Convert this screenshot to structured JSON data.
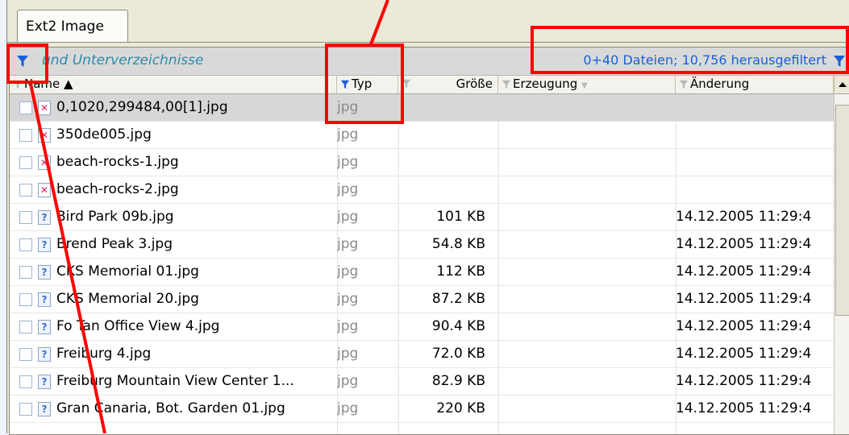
{
  "tab": {
    "label": "Ext2 Image"
  },
  "filterbar": {
    "subdirs_text": "und Unterverzeichnisse",
    "status": "0+40 Dateien; 10,756 herausgefiltert"
  },
  "columns": {
    "name": "Name ▲",
    "type": "Typ",
    "size": "Größe",
    "created": "Erzeugung",
    "modified": "Änderung"
  },
  "rows": [
    {
      "name": "0,1020,299484,00[1].jpg",
      "type": "jpg",
      "size": "",
      "created": "",
      "modified": "",
      "icon": "broken-image-icon"
    },
    {
      "name": "350de005.jpg",
      "type": "jpg",
      "size": "",
      "created": "",
      "modified": "",
      "icon": "broken-image-icon"
    },
    {
      "name": "beach-rocks-1.jpg",
      "type": "jpg",
      "size": "",
      "created": "",
      "modified": "",
      "icon": "broken-image-icon"
    },
    {
      "name": "beach-rocks-2.jpg",
      "type": "jpg",
      "size": "",
      "created": "",
      "modified": "",
      "icon": "broken-image-icon"
    },
    {
      "name": "Bird Park 09b.jpg",
      "type": "jpg",
      "size": "101 KB",
      "created": "",
      "modified": "14.12.2005  11:29:4",
      "icon": "unknown-file-icon"
    },
    {
      "name": "Brend Peak 3.jpg",
      "type": "jpg",
      "size": "54.8 KB",
      "created": "",
      "modified": "14.12.2005  11:29:4",
      "icon": "unknown-file-icon"
    },
    {
      "name": "CKS Memorial 01.jpg",
      "type": "jpg",
      "size": "112 KB",
      "created": "",
      "modified": "14.12.2005  11:29:4",
      "icon": "unknown-file-icon"
    },
    {
      "name": "CKS Memorial 20.jpg",
      "type": "jpg",
      "size": "87.2 KB",
      "created": "",
      "modified": "14.12.2005  11:29:4",
      "icon": "unknown-file-icon"
    },
    {
      "name": "Fo Tan Office View 4.jpg",
      "type": "jpg",
      "size": "90.4 KB",
      "created": "",
      "modified": "14.12.2005  11:29:4",
      "icon": "unknown-file-icon"
    },
    {
      "name": "Freiburg 4.jpg",
      "type": "jpg",
      "size": "72.0 KB",
      "created": "",
      "modified": "14.12.2005  11:29:4",
      "icon": "unknown-file-icon"
    },
    {
      "name": "Freiburg Mountain View Center 1...",
      "type": "jpg",
      "size": "82.9 KB",
      "created": "",
      "modified": "14.12.2005  11:29:4",
      "icon": "unknown-file-icon"
    },
    {
      "name": "Gran Canaria, Bot. Garden 01.jpg",
      "type": "jpg",
      "size": "220 KB",
      "created": "",
      "modified": "14.12.2005  11:29:4",
      "icon": "unknown-file-icon"
    }
  ],
  "colors": {
    "filter_icon": "#1b5fd9",
    "annotation": "#ff0000",
    "status_text": "#1b5fd9",
    "subdirs_text": "#2f8aa8"
  }
}
